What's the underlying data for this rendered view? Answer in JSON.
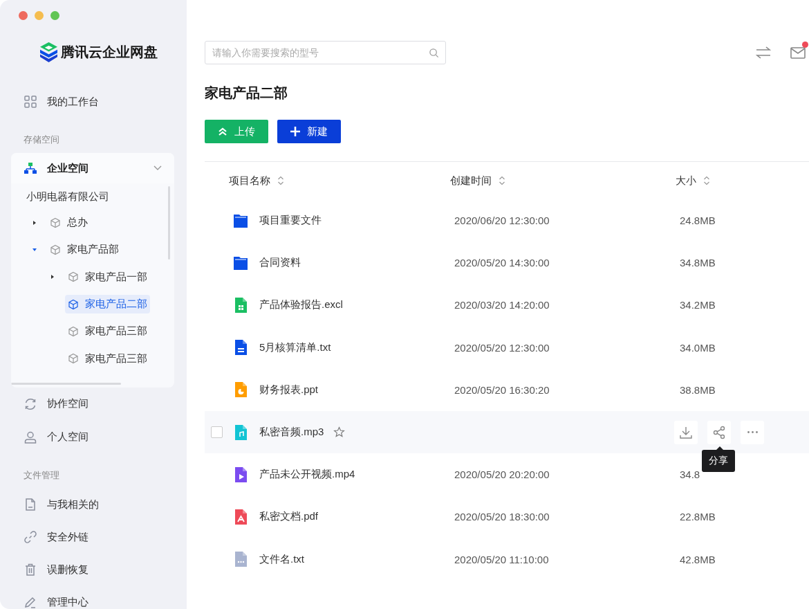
{
  "app": {
    "title": "腾讯云企业网盘"
  },
  "sidebar": {
    "top": [
      {
        "label": "我的工作台",
        "selected": false
      }
    ],
    "storage_heading": "存储空间",
    "enterprise": {
      "label": "企业空间",
      "expanded": true,
      "company": "小明电器有限公司",
      "tree": [
        {
          "label": "总办",
          "expanded": false,
          "selected": false
        },
        {
          "label": "家电产品部",
          "expanded": true,
          "selected": false,
          "children": [
            {
              "label": "家电产品一部",
              "expanded": false,
              "selected": false
            },
            {
              "label": "家电产品二部",
              "selected": true
            },
            {
              "label": "家电产品三部",
              "selected": false
            },
            {
              "label": "家电产品三部",
              "selected": false
            }
          ]
        }
      ]
    },
    "spaces": [
      {
        "label": "协作空间",
        "selected": false
      },
      {
        "label": "个人空间",
        "selected": false
      }
    ],
    "files_heading": "文件管理",
    "files": [
      {
        "label": "与我相关的",
        "selected": false
      },
      {
        "label": "安全外链",
        "selected": false
      },
      {
        "label": "误删恢复",
        "selected": false
      },
      {
        "label": "管理中心",
        "selected": false
      }
    ]
  },
  "search": {
    "placeholder": "请输入你需要搜索的型号"
  },
  "header": {
    "unread": true
  },
  "folder_title": "家电产品二部",
  "buttons": [
    {
      "label": "上传",
      "kind": "upload"
    },
    {
      "label": "新建",
      "kind": "new"
    }
  ],
  "table": {
    "columns": [
      "项目名称",
      "创建时间",
      "大小"
    ],
    "rows": [
      {
        "name": "项目重要文件",
        "kind": "folder",
        "created": "2020/06/20 12:30:00",
        "size": "24.8MB",
        "hovered": false
      },
      {
        "name": "合同资料",
        "kind": "folder",
        "created": "2020/05/20 14:30:00",
        "size": "34.8MB",
        "hovered": false
      },
      {
        "name": "产品体验报告.excl",
        "kind": "sheet",
        "created": "2020/03/20 14:20:00",
        "size": "34.2MB",
        "hovered": false
      },
      {
        "name": "5月核算清单.txt",
        "kind": "doc",
        "created": "2020/05/20 12:30:00",
        "size": "34.0MB",
        "hovered": false
      },
      {
        "name": "财务报表.ppt",
        "kind": "slides",
        "created": "2020/05/20 16:30:20",
        "size": "38.8MB",
        "hovered": false
      },
      {
        "name": "私密音频.mp3",
        "kind": "audio",
        "hovered": true,
        "checked": false,
        "starred": false,
        "tooltip": "分享"
      },
      {
        "name": "产品未公开视频.mp4",
        "kind": "video",
        "created": "2020/05/20 20:20:00",
        "size": "34.8",
        "hovered": false
      },
      {
        "name": "私密文档.pdf",
        "kind": "pdf",
        "created": "2020/05/20 18:30:00",
        "size": "22.8MB",
        "hovered": false
      },
      {
        "name": "文件名.txt",
        "kind": "other",
        "created": "2020/05/20 11:10:00",
        "size": "42.8MB",
        "hovered": false
      }
    ]
  }
}
